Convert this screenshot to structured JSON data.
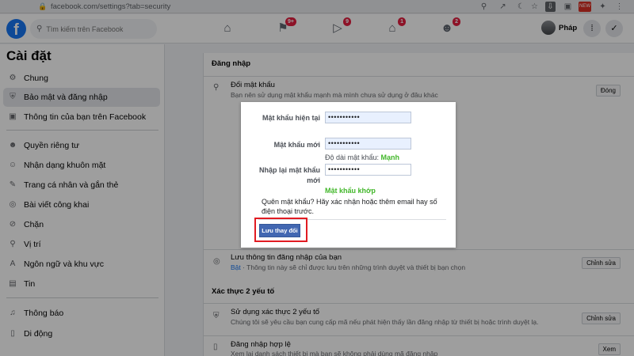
{
  "browser": {
    "url": "facebook.com/settings?tab=security",
    "lock_icon": "lock-icon",
    "new_badge": "NEW"
  },
  "topnav": {
    "logo": "f",
    "search_placeholder": "Tìm kiếm trên Facebook",
    "flag_badge": "9+",
    "watch_badge": "9",
    "marketplace_badge": "1",
    "groups_badge": "2",
    "profile_name": "Pháp"
  },
  "sidebar": {
    "title": "Cài đặt",
    "items": [
      {
        "label": "Chung",
        "icon": "gear-icon"
      },
      {
        "label": "Bảo mật và đăng nhập",
        "icon": "shield-icon"
      },
      {
        "label": "Thông tin của bạn trên Facebook",
        "icon": "facebook-icon"
      },
      {
        "label": "Quyền riêng tư",
        "icon": "person-lock-icon"
      },
      {
        "label": "Nhận dạng khuôn mặt",
        "icon": "face-icon"
      },
      {
        "label": "Trang cá nhân và gắn thẻ",
        "icon": "tag-icon"
      },
      {
        "label": "Bài viết công khai",
        "icon": "globe-icon"
      },
      {
        "label": "Chặn",
        "icon": "block-icon"
      },
      {
        "label": "Vị trí",
        "icon": "location-icon"
      },
      {
        "label": "Ngôn ngữ và khu vực",
        "icon": "language-icon"
      },
      {
        "label": "Tin",
        "icon": "story-icon"
      },
      {
        "label": "Thông báo",
        "icon": "bell-icon"
      },
      {
        "label": "Di động",
        "icon": "mobile-icon"
      }
    ]
  },
  "main": {
    "login_section": "Đăng nhập",
    "change_password": {
      "title": "Đổi mật khẩu",
      "subtitle": "Bạn nên sử dụng mật khẩu mạnh mà mình chưa sử dụng ở đâu khác",
      "button": "Đóng"
    },
    "save_login": {
      "title": "Lưu thông tin đăng nhập của bạn",
      "status": "Bật",
      "subtitle": " · Thông tin này sẽ chỉ được lưu trên những trình duyệt và thiết bị bạn chọn",
      "button": "Chỉnh sửa"
    },
    "twofa_section": "Xác thực 2 yếu tố",
    "use_2fa": {
      "title": "Sử dụng xác thực 2 yếu tố",
      "subtitle": "Chúng tôi sẽ yêu cầu bạn cung cấp mã nếu phát hiện thấy lần đăng nhập từ thiết bị hoặc trình duyệt lạ.",
      "button": "Chỉnh sửa"
    },
    "authorized_logins": {
      "title": "Đăng nhập hợp lệ",
      "subtitle": "Xem lại danh sách thiết bị mà bạn sẽ không phải dùng mã đăng nhập",
      "button": "Xem"
    }
  },
  "modal": {
    "current_label": "Mật khẩu hiện tại",
    "current_value": "•••••••••••",
    "new_label": "Mật khẩu mới",
    "new_value": "•••••••••••",
    "strength_text": "Độ dài mật khẩu: ",
    "strength_value": "Mạnh",
    "confirm_label": "Nhập lại mật khẩu mới",
    "confirm_value": "•••••••••••",
    "match_text": "Mật khẩu khớp",
    "forgot_text": "Quên mật khẩu? Hãy xác nhận hoặc thêm email hay số điện thoại trước.",
    "save_button": "Lưu thay đổi"
  },
  "colors": {
    "brand": "#1877f2",
    "save_button": "#4267b2",
    "highlight": "#e11b22",
    "success": "#42b72a"
  }
}
